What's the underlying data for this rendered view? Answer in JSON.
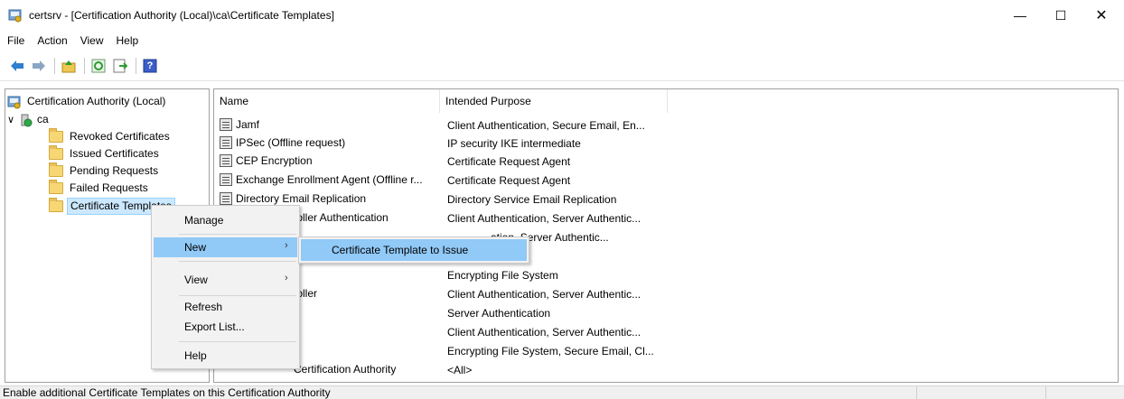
{
  "window": {
    "title": "certsrv - [Certification Authority (Local)\\ca\\Certificate Templates]",
    "minimize": "—",
    "maximize": "☐",
    "close": "✕"
  },
  "menu": [
    "File",
    "Action",
    "View",
    "Help"
  ],
  "toolbar": {
    "icons": [
      "back-arrow-icon",
      "forward-arrow-icon",
      "up-folder-icon",
      "refresh-icon",
      "export-list-icon",
      "help-icon"
    ],
    "help_glyph": "?"
  },
  "tree": {
    "root": "Certification Authority (Local)",
    "ca_node": "ca",
    "expander": "∨",
    "children": [
      "Revoked Certificates",
      "Issued Certificates",
      "Pending Requests",
      "Failed Requests",
      "Certificate Templates"
    ]
  },
  "list": {
    "columns": [
      "Name",
      "Intended Purpose"
    ],
    "rows": [
      {
        "name": "Jamf",
        "purpose": "Client Authentication, Secure Email, En..."
      },
      {
        "name": "IPSec (Offline request)",
        "purpose": "IP security IKE intermediate"
      },
      {
        "name": "CEP Encryption",
        "purpose": "Certificate Request Agent"
      },
      {
        "name": "Exchange Enrollment Agent (Offline r...",
        "purpose": "Certificate Request Agent"
      },
      {
        "name": "Directory Email Replication",
        "purpose": "Directory Service Email Replication"
      },
      {
        "name": "troller Authentication",
        "purpose": "Client Authentication, Server Authentic..."
      },
      {
        "name": "",
        "purpose": "ation, Server Authentic..."
      },
      {
        "name": "",
        "purpose": ""
      },
      {
        "name": "",
        "purpose": "Encrypting File System"
      },
      {
        "name": "troller",
        "purpose": "Client Authentication, Server Authentic..."
      },
      {
        "name": "",
        "purpose": "Server Authentication"
      },
      {
        "name": "",
        "purpose": "Client Authentication, Server Authentic..."
      },
      {
        "name": "",
        "purpose": "Encrypting File System, Secure Email, Cl..."
      },
      {
        "name": "Certification Authority",
        "purpose": "<All>"
      }
    ]
  },
  "context_menu": {
    "items": [
      "Manage",
      "New",
      "View",
      "Refresh",
      "Export List...",
      "Help"
    ],
    "submenu_arrow": "›",
    "submenu_item": "Certificate Template to Issue"
  },
  "status": {
    "text": "Enable additional Certificate Templates on this Certification Authority"
  },
  "colors": {
    "selection": "#cce8ff",
    "menu_highlight": "#91c9f7",
    "folder": "#f7d774"
  }
}
